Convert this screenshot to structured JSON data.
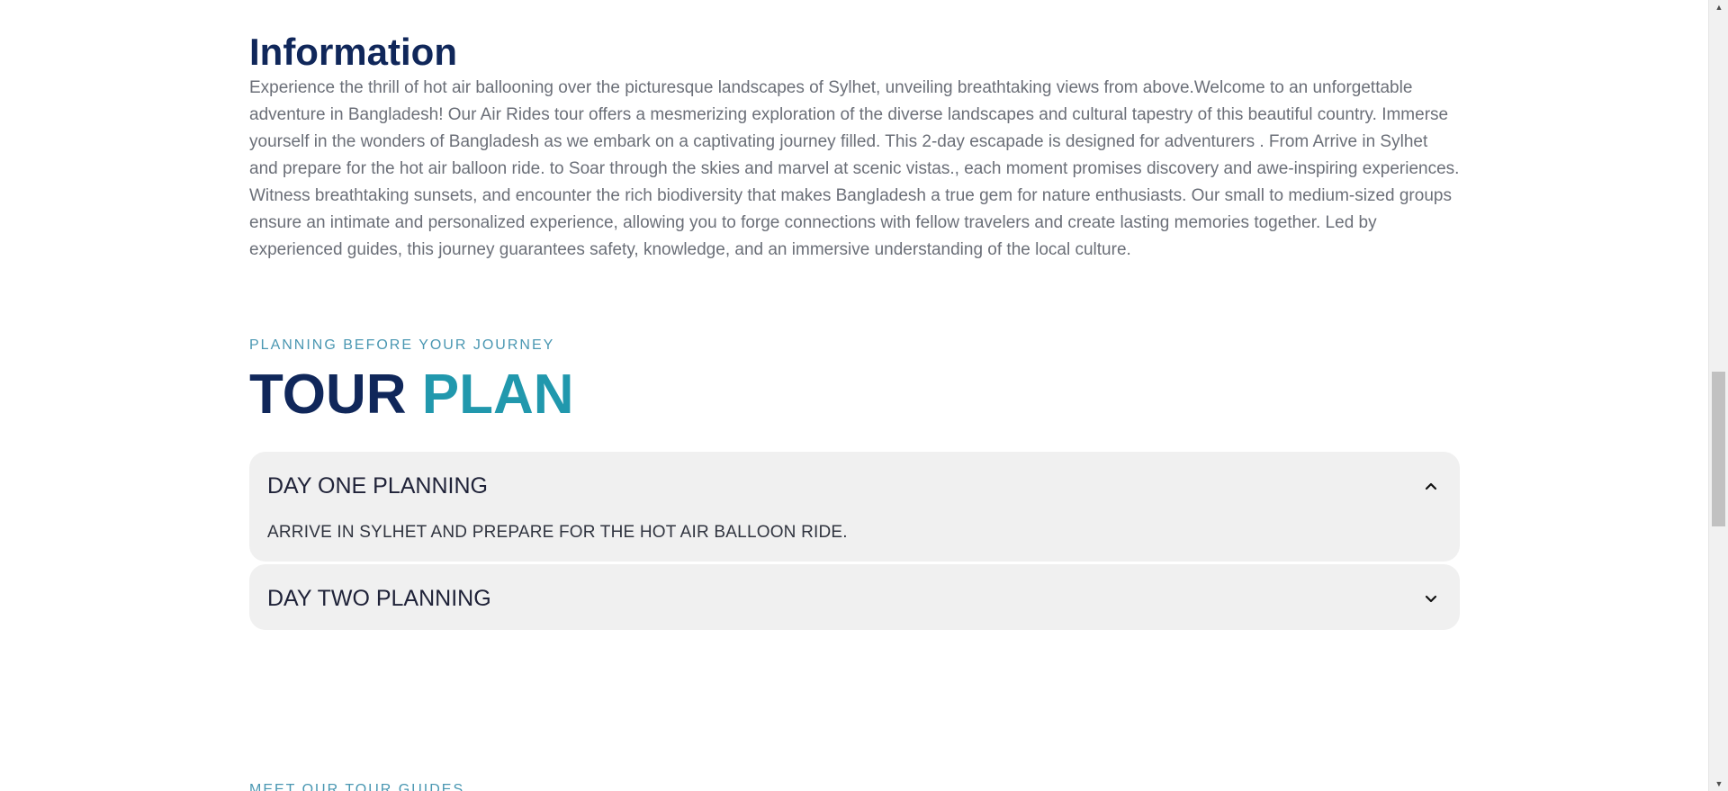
{
  "information": {
    "title": "Information",
    "text": "Experience the thrill of hot air ballooning over the picturesque landscapes of Sylhet, unveiling breathtaking views from above.Welcome to an unforgettable adventure in Bangladesh! Our Air Rides tour offers a mesmerizing exploration of the diverse landscapes and cultural tapestry of this beautiful country. Immerse yourself in the wonders of Bangladesh as we embark on a captivating journey filled. This 2-day escapade is designed for adventurers . From Arrive in Sylhet and prepare for the hot air balloon ride. to Soar through the skies and marvel at scenic vistas., each moment promises discovery and awe-inspiring experiences. Witness breathtaking sunsets, and encounter the rich biodiversity that makes Bangladesh a true gem for nature enthusiasts. Our small to medium-sized groups ensure an intimate and personalized experience, allowing you to forge connections with fellow travelers and create lasting memories together. Led by experienced guides, this journey guarantees safety, knowledge, and an immersive understanding of the local culture."
  },
  "tour_plan": {
    "subtitle": "PLANNING BEFORE YOUR JOURNEY",
    "title_main": "TOUR",
    "title_accent": "PLAN",
    "days": [
      {
        "title": "DAY ONE PLANNING",
        "body": "ARRIVE IN SYLHET AND PREPARE FOR THE HOT AIR BALLOON RIDE.",
        "expanded": true,
        "icon": "chevron-up-icon"
      },
      {
        "title": "DAY TWO PLANNING",
        "body": "",
        "expanded": false,
        "icon": "chevron-down-icon"
      }
    ]
  },
  "guides": {
    "subtitle": "MEET OUR TOUR GUIDES"
  },
  "colors": {
    "title_navy": "#10275a",
    "accent_teal": "#2198ad",
    "subtitle_blue": "#4a97b2",
    "body_gray": "#6b6f78",
    "accordion_bg": "#f0f0f0"
  }
}
